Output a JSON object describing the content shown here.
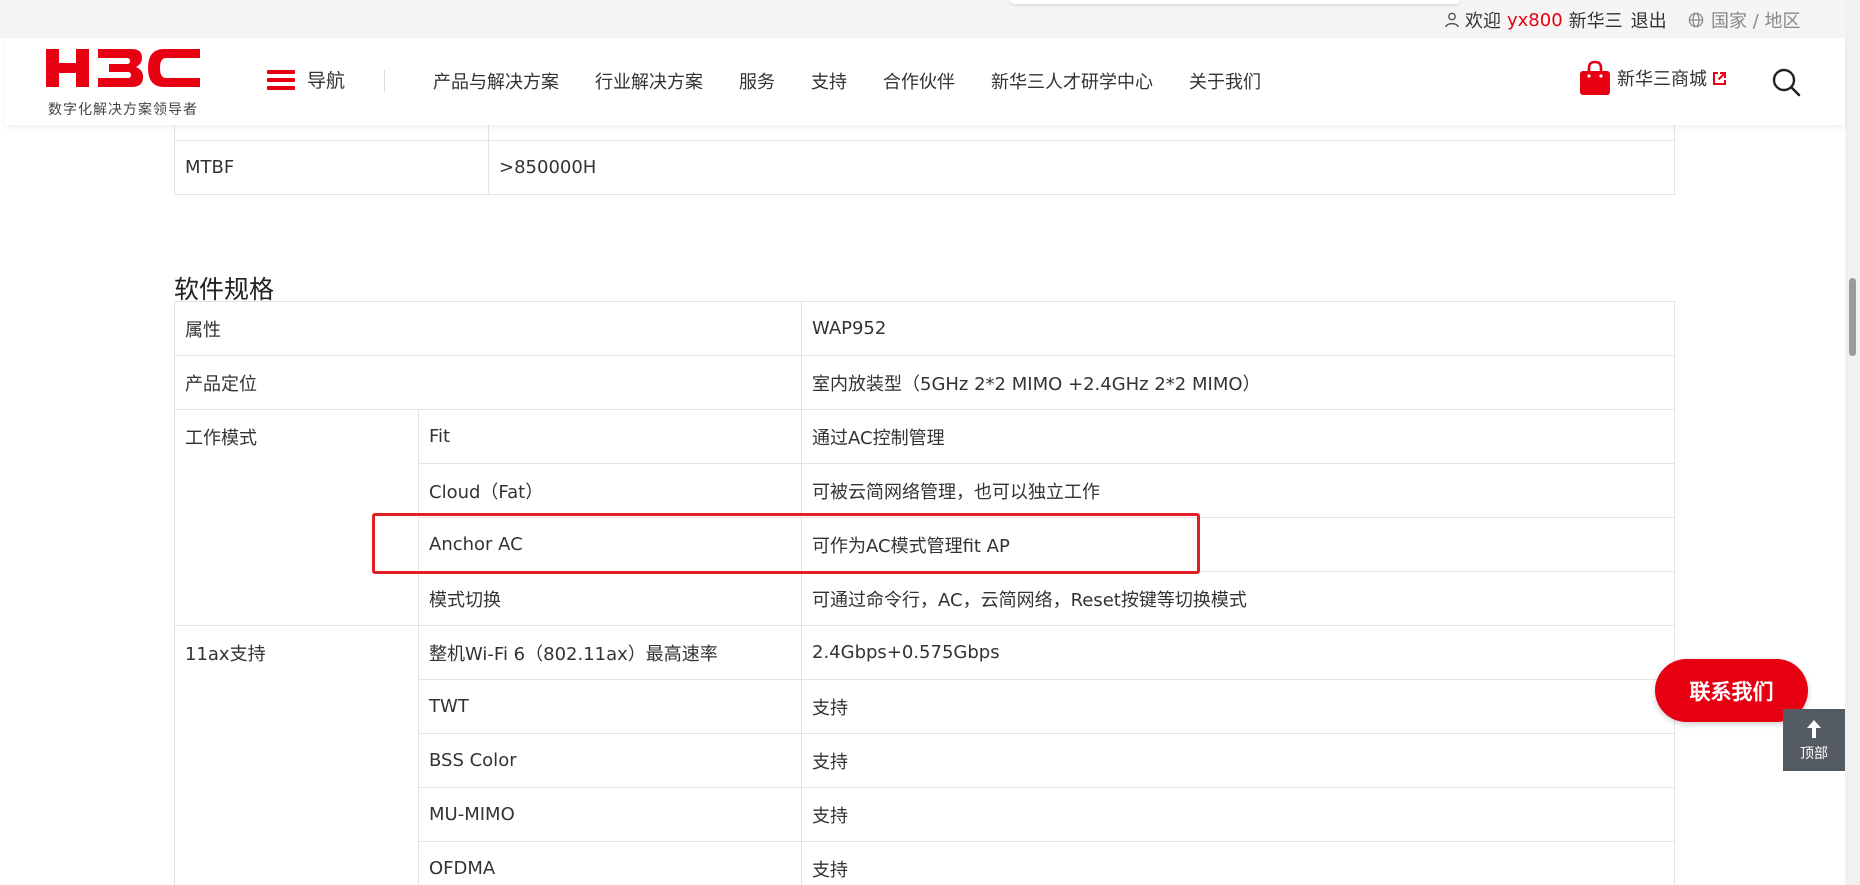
{
  "topbar": {
    "welcome": "欢迎",
    "username": "yx800",
    "company": "新华三",
    "logout": "退出",
    "region": "国家 / 地区"
  },
  "header": {
    "logo_tagline": "数字化解决方案领导者",
    "nav_toggle": "导航",
    "nav_items": [
      {
        "label": "产品与解决方案"
      },
      {
        "label": "行业解决方案"
      },
      {
        "label": "服务"
      },
      {
        "label": "支持"
      },
      {
        "label": "合作伙伴"
      },
      {
        "label": "新华三人才研学中心"
      },
      {
        "label": "关于我们"
      }
    ],
    "shop_label": "新华三商城"
  },
  "hardware_spec": {
    "rows": [
      {
        "attr": "MTBF",
        "value": ">850000H"
      }
    ]
  },
  "software_spec": {
    "title": "软件规格",
    "header": {
      "attr": "属性",
      "value": "WAP952"
    },
    "positioning": {
      "attr": "产品定位",
      "value": "室内放装型（5GHz 2*2 MIMO +2.4GHz 2*2 MIMO）"
    },
    "work_mode": {
      "group": "工作模式",
      "rows": [
        {
          "sub": "Fit",
          "value": "通过AC控制管理"
        },
        {
          "sub": "Cloud（Fat）",
          "value": "可被云简网络管理，也可以独立工作"
        },
        {
          "sub": "Anchor AC",
          "value": "可作为AC模式管理fit AP"
        },
        {
          "sub": "模式切换",
          "value": "可通过命令行，AC，云简网络，Reset按键等切换模式"
        }
      ]
    },
    "ax_support": {
      "group": "11ax支持",
      "rows": [
        {
          "sub": "整机Wi-Fi 6（802.11ax）最高速率",
          "value": "2.4Gbps+0.575Gbps"
        },
        {
          "sub": "TWT",
          "value": "支持"
        },
        {
          "sub": "BSS Color",
          "value": "支持"
        },
        {
          "sub": "MU-MIMO",
          "value": "支持"
        },
        {
          "sub": "OFDMA",
          "value": "支持"
        }
      ]
    }
  },
  "floating": {
    "contact": "联系我们",
    "back_to_top": "顶部"
  },
  "colors": {
    "brand_red": "#e60012",
    "highlight_red": "#e31e24",
    "border": "#e3e3e3"
  }
}
